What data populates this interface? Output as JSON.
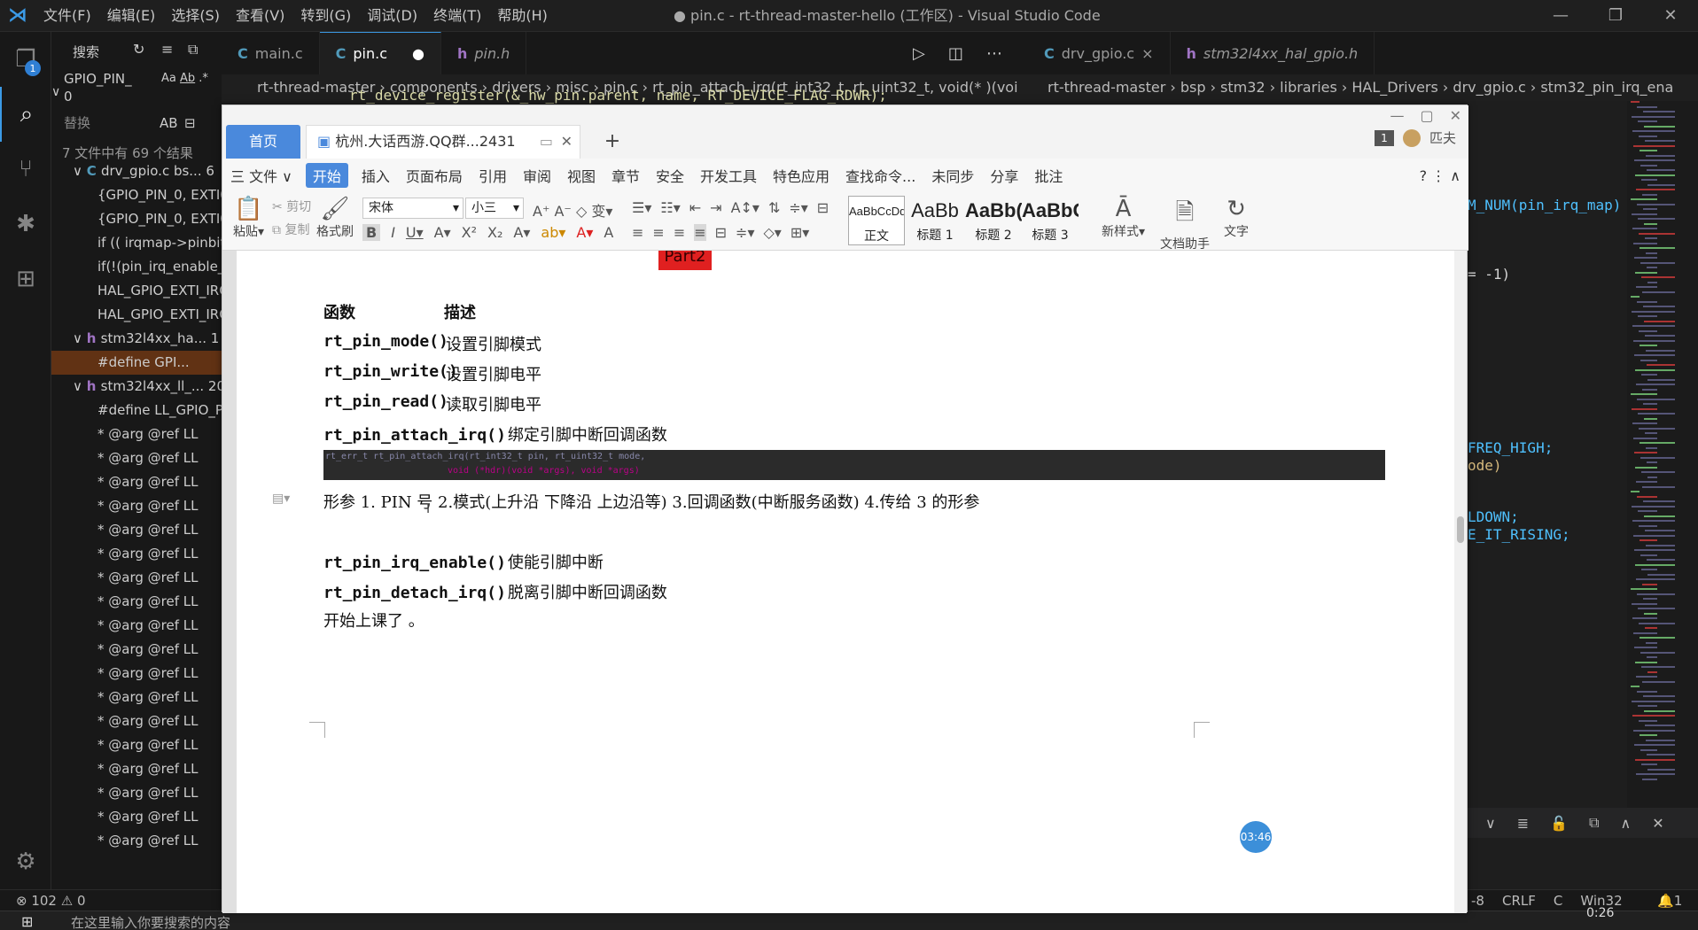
{
  "titlebar": {
    "menus": [
      "文件(F)",
      "编辑(E)",
      "选择(S)",
      "查看(V)",
      "转到(G)",
      "调试(D)",
      "终端(T)",
      "帮助(H)"
    ],
    "title": "● pin.c - rt-thread-master-hello (工作区) - Visual Studio Code"
  },
  "activity": {
    "badge": "1"
  },
  "sidebar": {
    "search_label": "搜索",
    "search_value": "GPIO_PIN_",
    "search_count": "0",
    "replace_placeholder": "替换",
    "replace_ab": "AB",
    "summary": "7 文件中有 69 个结果",
    "rows": [
      {
        "t": "drv_gpio.c bs... 6",
        "k": "file-c",
        "indent": 24
      },
      {
        "t": "{GPIO_PIN_0, EXTI0_",
        "k": "match",
        "indent": 30
      },
      {
        "t": "{GPIO_PIN_0, EXTI0_",
        "k": "match",
        "indent": 30
      },
      {
        "t": "if (( irqmap->pinbit",
        "k": "match",
        "indent": 30
      },
      {
        "t": "if(!(pin_irq_enable_m",
        "k": "match",
        "indent": 30
      },
      {
        "t": "HAL_GPIO_EXTI_IRQ",
        "k": "match",
        "indent": 30
      },
      {
        "t": "HAL_GPIO_EXTI_IRQ",
        "k": "match",
        "indent": 30
      },
      {
        "t": "stm32l4xx_ha... 1",
        "k": "file-h",
        "indent": 24
      },
      {
        "t": "#define GPI...",
        "k": "match-sel",
        "indent": 30
      },
      {
        "t": "stm32l4xx_ll_... 20",
        "k": "file-h",
        "indent": 24
      },
      {
        "t": "#define LL_GPIO_PIN",
        "k": "match",
        "indent": 30
      },
      {
        "t": "*        @arg @ref LL",
        "k": "match",
        "indent": 30
      },
      {
        "t": "*        @arg @ref LL",
        "k": "match",
        "indent": 30
      },
      {
        "t": "*        @arg @ref LL",
        "k": "match",
        "indent": 30
      },
      {
        "t": "*        @arg @ref LL",
        "k": "match",
        "indent": 30
      },
      {
        "t": "*        @arg @ref LL",
        "k": "match",
        "indent": 30
      },
      {
        "t": "*        @arg @ref LL",
        "k": "match",
        "indent": 30
      },
      {
        "t": "*        @arg @ref LL",
        "k": "match",
        "indent": 30
      },
      {
        "t": "*        @arg @ref LL",
        "k": "match",
        "indent": 30
      },
      {
        "t": "*        @arg @ref LL",
        "k": "match",
        "indent": 30
      },
      {
        "t": "*        @arg @ref LL",
        "k": "match",
        "indent": 30
      },
      {
        "t": "*        @arg @ref LL",
        "k": "match",
        "indent": 30
      },
      {
        "t": "*        @arg @ref LL",
        "k": "match",
        "indent": 30
      },
      {
        "t": "*        @arg @ref LL",
        "k": "match",
        "indent": 30
      },
      {
        "t": "*        @arg @ref LL",
        "k": "match",
        "indent": 30
      },
      {
        "t": "*        @arg @ref LL",
        "k": "match",
        "indent": 30
      },
      {
        "t": "*        @arg @ref LL",
        "k": "match",
        "indent": 30
      },
      {
        "t": "*        @arg @ref LL",
        "k": "match",
        "indent": 30
      },
      {
        "t": "*        @arg @ref LL",
        "k": "match",
        "indent": 30
      }
    ]
  },
  "tabs_left": [
    {
      "name": "main.c",
      "type": "c"
    },
    {
      "name": "pin.c",
      "type": "c",
      "dirty": true
    },
    {
      "name": "pin.h",
      "type": "h"
    }
  ],
  "tabs_right": [
    {
      "name": "drv_gpio.c",
      "type": "c",
      "close": "×"
    },
    {
      "name": "stm32l4xx_hal_gpio.h",
      "type": "h"
    }
  ],
  "crumb_left": "rt-thread-master  ›  components  ›  drivers  ›  misc  ›  pin.c  ›  rt_pin_attach_irq(rt_int32_t, rt_uint32_t, void(* )(voi",
  "crumb_right": "rt-thread-master  ›  bsp  ›  stm32  ›  libraries  ›  HAL_Drivers  ›  drv_gpio.c  ›  stm32_pin_irq_ena",
  "code_right": [
    {
      "t": "M_NUM(pin_irq_map)",
      "c": "#4fc1ff"
    },
    {
      "t": "= -1)",
      "c": "#d4d4d4"
    },
    {
      "t": "FREQ_HIGH;",
      "c": "#4fc1ff"
    },
    {
      "t": "ode)",
      "c": "#d7ba7d"
    },
    {
      "t": "LDOWN;",
      "c": "#4fc1ff"
    },
    {
      "t": "E_IT_RISING;",
      "c": "#4fc1ff"
    }
  ],
  "code_left_top": "rt_device_register(&_hw_pin.parent, name, RT_DEVICE_FLAG_RDWR);",
  "statusbar": {
    "errors": "⊗ 102",
    "warnings": "⚠ 0",
    "right": [
      "-8",
      "CRLF",
      "C",
      "Win32"
    ],
    "bell": "1"
  },
  "taskbar": {
    "search": "在这里输入你要搜索的内容",
    "time": "0:26"
  },
  "wps": {
    "home_tab": "首页",
    "doc_tab": "杭州.大话西游.QQ群...2431",
    "user": "匹夫",
    "page_badge": "1",
    "menus": [
      "三 文件 ∨",
      "开始",
      "插入",
      "页面布局",
      "引用",
      "审阅",
      "视图",
      "章节",
      "安全",
      "开发工具",
      "特色应用",
      "查找命令...",
      "未同步",
      "分享",
      "批注"
    ],
    "font": "宋体",
    "size": "小三",
    "ribbon": {
      "paste": "粘贴",
      "cut": "剪切",
      "copy": "复制",
      "format_painter": "格式刷",
      "new_style": "新样式",
      "doc_helper": "文档助手",
      "text_tool": "文字"
    },
    "styles": [
      {
        "preview": "AaBbCcDd",
        "name": "正文"
      },
      {
        "preview": "AaBb",
        "name": "标题 1"
      },
      {
        "preview": "AaBb(",
        "name": "标题 2"
      },
      {
        "preview": "AaBbC(",
        "name": "标题 3"
      }
    ],
    "red_tag": "Part2",
    "doc": {
      "header_fn": "函数",
      "header_desc": "描述",
      "rows": [
        {
          "fn": "rt_pin_mode()",
          "desc": "设置引脚模式"
        },
        {
          "fn": "rt_pin_write()",
          "desc": "设置引脚电平"
        },
        {
          "fn": "rt_pin_read()",
          "desc": "读取引脚电平"
        },
        {
          "fn": "rt_pin_attach_irq()",
          "desc": "绑定引脚中断回调函数"
        }
      ],
      "code1": "rt_err_t rt_pin_attach_irq(rt_int32_t pin, rt_uint32_t mode,",
      "code2": "void (*hdr)(void *args), void  *args)",
      "params": "形参 1. PIN 号  2.模式(上升沿 下降沿 上边沿等) 3.回调函数(中断服务函数) 4.传给 3 的形参",
      "rows2": [
        {
          "fn": "rt_pin_irq_enable()",
          "desc": "使能引脚中断"
        },
        {
          "fn": "rt_pin_detach_irq()",
          "desc": "脱离引脚中断回调函数"
        }
      ],
      "last": "开始上课了 。"
    },
    "timer": "03:46"
  }
}
